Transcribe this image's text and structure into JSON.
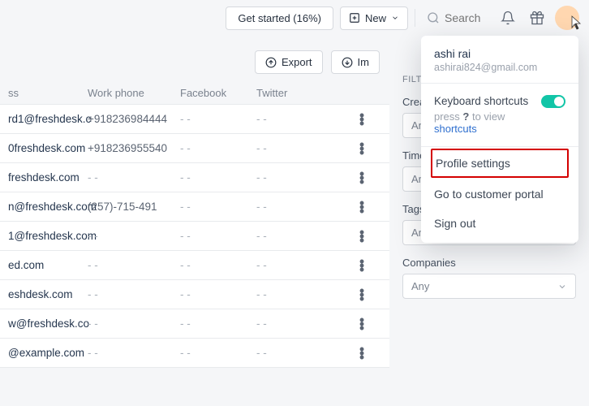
{
  "header": {
    "get_started": "Get started (16%)",
    "new_label": "New",
    "search_placeholder": "Search"
  },
  "toolbar": {
    "export_label": "Export",
    "import_label": "Im"
  },
  "columns": {
    "ss": "ss",
    "phone": "Work phone",
    "facebook": "Facebook",
    "twitter": "Twitter"
  },
  "rows": [
    {
      "ss": "rd1@freshdesk.c",
      "phone": "+918236984444",
      "fb": "- -",
      "tw": "- -"
    },
    {
      "ss": "0freshdesk.com",
      "phone": "+918236955540",
      "fb": "- -",
      "tw": "- -"
    },
    {
      "ss": "freshdesk.com",
      "phone": "- -",
      "fb": "- -",
      "tw": "- -"
    },
    {
      "ss": "n@freshdesk.com",
      "phone": "(257)-715-491",
      "fb": "- -",
      "tw": "- -"
    },
    {
      "ss": "1@freshdesk.com",
      "phone": "- -",
      "fb": "- -",
      "tw": "- -"
    },
    {
      "ss": "ed.com",
      "phone": "- -",
      "fb": "- -",
      "tw": "- -"
    },
    {
      "ss": "eshdesk.com",
      "phone": "- -",
      "fb": "- -",
      "tw": "- -"
    },
    {
      "ss": "w@freshdesk.co",
      "phone": "- -",
      "fb": "- -",
      "tw": "- -"
    },
    {
      "ss": "@example.com",
      "phone": "- -",
      "fb": "- -",
      "tw": "- -"
    }
  ],
  "filters": {
    "label": "FILTER",
    "created": {
      "title": "Create",
      "value": "An"
    },
    "time": {
      "title": "Time",
      "value": "An"
    },
    "tags": {
      "title": "Tags",
      "value": "Any"
    },
    "companies": {
      "title": "Companies",
      "value": "Any"
    }
  },
  "profile_menu": {
    "name": "ashi rai",
    "email": "ashirai824@gmail.com",
    "kb_title": "Keyboard shortcuts",
    "kb_press": "press ",
    "kb_key": "?",
    "kb_toview": " to view ",
    "kb_link": "shortcuts",
    "profile_settings": "Profile settings",
    "customer_portal": "Go to customer portal",
    "sign_out": "Sign out"
  }
}
